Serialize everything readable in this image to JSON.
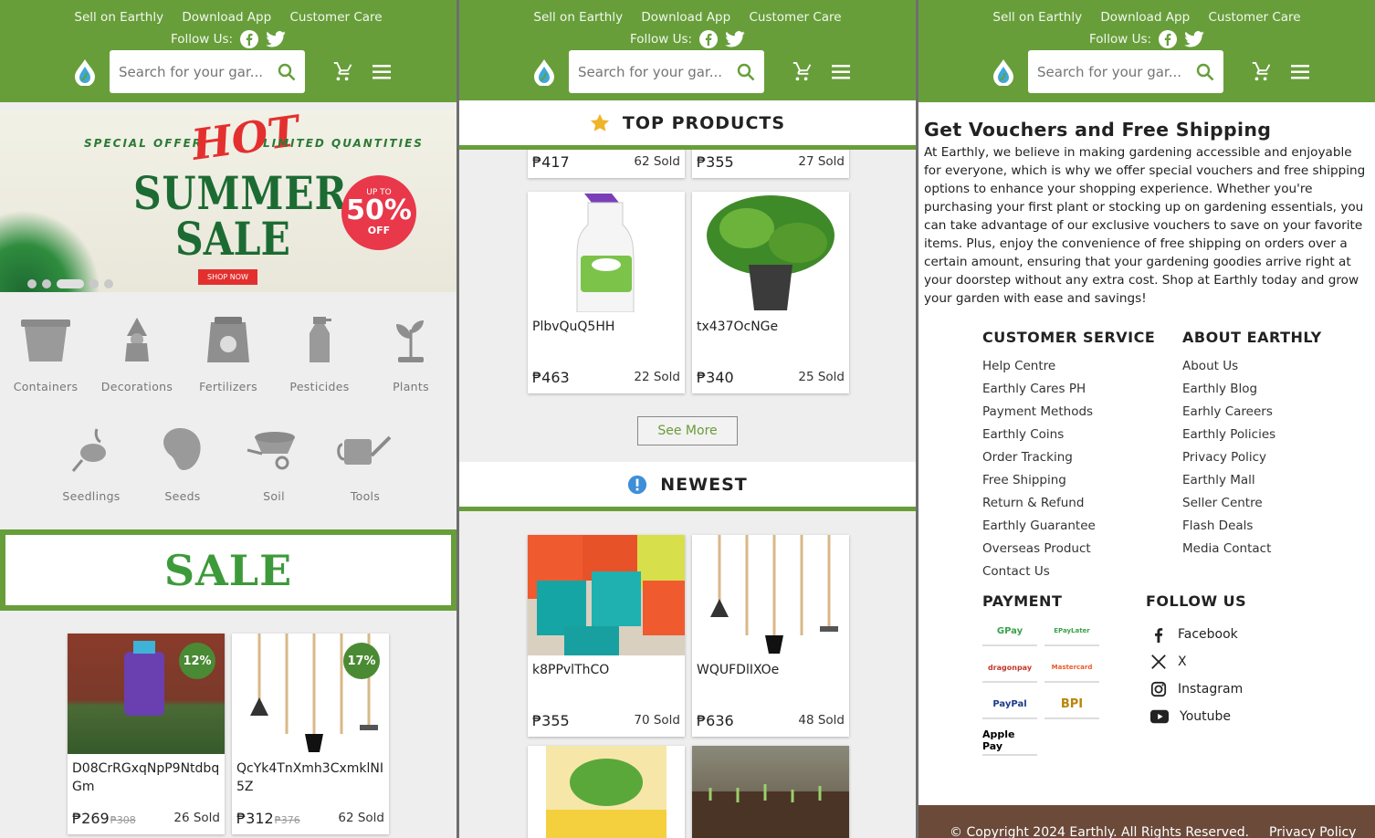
{
  "header": {
    "links": [
      "Sell on Earthly",
      "Download App",
      "Customer Care"
    ],
    "follow_label": "Follow Us:",
    "search_placeholder": "Search for your gar...",
    "brand_color": "#679e3a"
  },
  "banner": {
    "special_offer": "SPECIAL OFFER",
    "hot": "HOT",
    "limited": "LIMITED QUANTITIES",
    "line1": "SUMMER",
    "line2": "SALE",
    "up_to": "UP TO",
    "percent": "50%",
    "off": "OFF",
    "shop_now": "SHOP NOW"
  },
  "categories": [
    "Containers",
    "Decorations",
    "Fertilizers",
    "Pesticides",
    "Plants",
    "Seedlings",
    "Seeds",
    "Soil",
    "Tools"
  ],
  "sale_title": "SALE",
  "sale_products": [
    {
      "name": "D08CrRGxqNpP9Ntdbq Gm",
      "price": "₱269",
      "old_price": "₱308",
      "sold": "26 Sold",
      "discount": "12%"
    },
    {
      "name": "QcYk4TnXmh3CxmklNI 5Z",
      "price": "₱312",
      "old_price": "₱376",
      "sold": "62 Sold",
      "discount": "17%"
    }
  ],
  "top_products": {
    "title": "TOP PRODUCTS",
    "partial": [
      {
        "price": "₱417",
        "sold": "62 Sold"
      },
      {
        "price": "₱355",
        "sold": "27 Sold"
      }
    ],
    "items": [
      {
        "name": "PlbvQuQ5HH",
        "price": "₱463",
        "sold": "22 Sold"
      },
      {
        "name": "tx437OcNGe",
        "price": "₱340",
        "sold": "25 Sold"
      }
    ],
    "see_more": "See More"
  },
  "newest": {
    "title": "NEWEST",
    "items": [
      {
        "name": "k8PPvlThCO",
        "price": "₱355",
        "sold": "70 Sold"
      },
      {
        "name": "WQUFDlIXOe",
        "price": "₱636",
        "sold": "48 Sold"
      }
    ]
  },
  "vouchers": {
    "title": "Get Vouchers and Free Shipping",
    "text": "At Earthly, we believe in making gardening accessible and enjoyable for everyone, which is why we offer special vouchers and free shipping options to enhance your shopping experience. Whether you're purchasing your first plant or stocking up on gardening essentials, you can take advantage of our exclusive vouchers to save on your favorite items. Plus, enjoy the convenience of free shipping on orders over a certain amount, ensuring that your gardening goodies arrive right at your doorstep without any extra cost. Shop at Earthly today and grow your garden with ease and savings!"
  },
  "customer_service": {
    "title": "CUSTOMER SERVICE",
    "items": [
      "Help Centre",
      "Earthly Cares PH",
      "Payment Methods",
      "Earthly Coins",
      "Order Tracking",
      "Free Shipping",
      "Return & Refund",
      "Earthly Guarantee",
      "Overseas Product",
      "Contact Us"
    ]
  },
  "about": {
    "title": "ABOUT EARTHLY",
    "items": [
      "About Us",
      "Earthly Blog",
      "Earhly Careers",
      "Earthly Policies",
      "Privacy Policy",
      "Earthly Mall",
      "Seller Centre",
      "Flash Deals",
      "Media Contact"
    ]
  },
  "payment": {
    "title": "PAYMENT",
    "methods": [
      "GPay",
      "EPayLater",
      "dragonpay",
      "Mastercard",
      "PayPal",
      "BPI",
      "Apple Pay"
    ]
  },
  "follow": {
    "title": "FOLLOW US",
    "items": [
      "Facebook",
      "X",
      "Instagram",
      "Youtube"
    ]
  },
  "footer": {
    "copyright": "© Copyright 2024 Earthly. All Rights Reserved.",
    "privacy": "Privacy Policy"
  }
}
